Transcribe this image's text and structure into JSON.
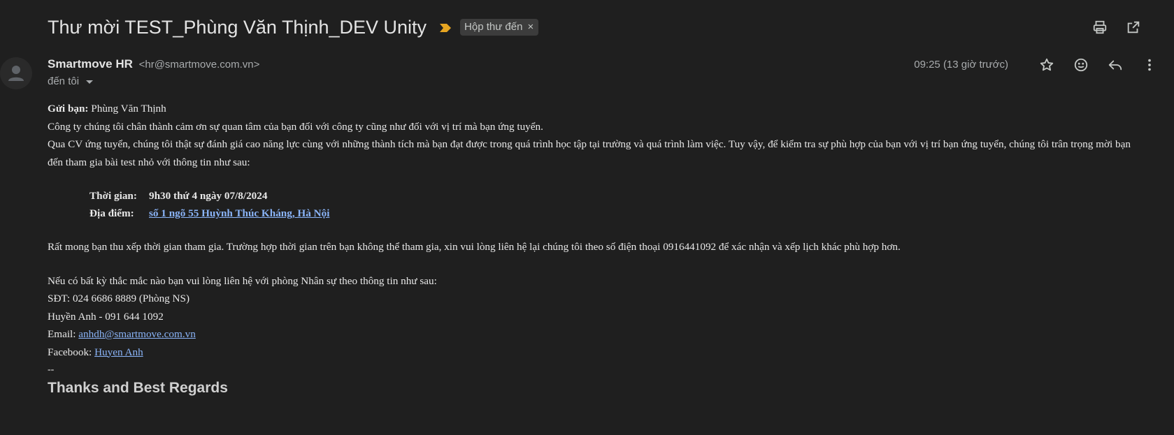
{
  "email": {
    "subject": "Thư mời TEST_Phùng Văn Thịnh_DEV Unity",
    "label_chip": "Hộp thư đến",
    "label_chip_close": "×",
    "sender_name": "Smartmove HR",
    "sender_email": "<hr@smartmove.com.vn>",
    "to_label": "đến tôi",
    "timestamp": "09:25 (13 giờ trước)"
  },
  "header_actions": {
    "print_icon": "print-icon",
    "open_new_window_icon": "open-in-new-icon"
  },
  "message_actions": {
    "star_icon": "star-icon",
    "emoji_icon": "emoji-icon",
    "reply_icon": "reply-icon",
    "more_icon": "more-vert-icon"
  },
  "body": {
    "greeting_label": "Gửi bạn:",
    "greeting_name": " Phùng Văn Thịnh",
    "line1": "Công ty chúng tôi chân thành cảm ơn sự quan tâm của bạn đối với công ty cũng như đối với vị trí mà bạn ứng tuyển.",
    "line2": "Qua CV ứng tuyển, chúng tôi thật sự đánh giá cao năng lực cùng với những thành tích mà bạn đạt được trong quá trình học tập tại trường và quá trình làm việc. Tuy vậy, để kiểm tra sự phù hợp của bạn với vị trí bạn ứng tuyển, chúng tôi trân trọng mời bạn đến tham gia bài test nhỏ với thông tin như sau:",
    "time_label": "Thời gian:",
    "time_value": "9h30 thứ 4 ngày 07/8/2024",
    "location_label": "Địa điểm:",
    "location_value": "số 1 ngõ 55 Huỳnh Thúc Kháng, Hà Nội",
    "line3": "Rất mong bạn thu xếp thời gian tham gia. Trường hợp thời gian trên bạn không thể tham gia, xin vui lòng liên hệ lại chúng tôi theo số điện thoại 0916441092 để xác nhận và xếp lịch khác phù hợp hơn.",
    "contact_intro": "Nếu có bất kỳ thắc mắc nào bạn  vui lòng liên hệ với phòng Nhân sự theo thông tin như sau:",
    "phone_line": "SĐT: 024 6686 8889 (Phòng NS)",
    "person_line": "Huyền Anh - 091 644 1092",
    "email_label": "Email: ",
    "email_value": "anhdh@smartmove.com.vn",
    "facebook_label": "Facebook: ",
    "facebook_value": "Huyen Anh",
    "signature_dash": "--",
    "signature_title": "Thanks and Best Regards"
  },
  "colors": {
    "background": "#1f1f1f",
    "link": "#8ab4f8",
    "importance_marker": "#e6a521"
  }
}
